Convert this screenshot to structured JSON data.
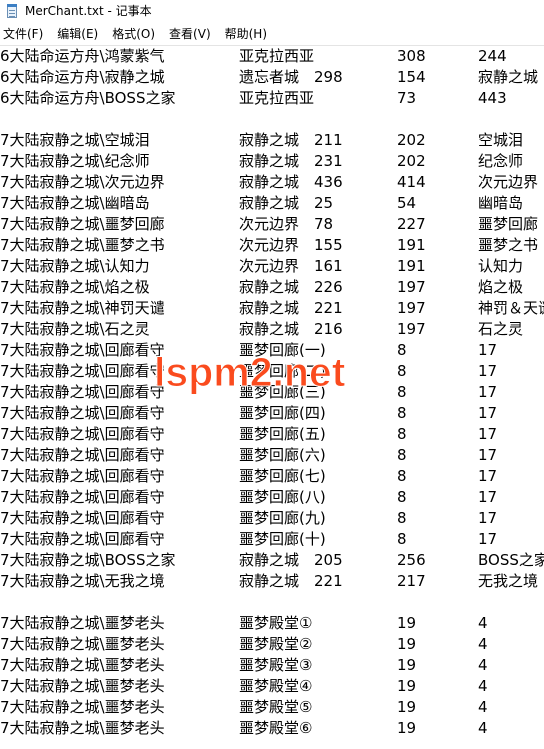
{
  "window": {
    "title": "MerChant.txt - 记事本",
    "app_icon": "notepad-icon"
  },
  "menu": [
    {
      "label": "文件(F)"
    },
    {
      "label": "编辑(E)"
    },
    {
      "label": "格式(O)"
    },
    {
      "label": "查看(V)"
    },
    {
      "label": "帮助(H)"
    }
  ],
  "watermark": "lspm2.net",
  "watermark_color": "#fa4b1e",
  "lines": [
    {
      "c1": "6大陆命运方舟\\鸿蒙紫气",
      "c2": "亚克拉西亚",
      "c3": "308",
      "c4": "244"
    },
    {
      "c1": "6大陆命运方舟\\寂静之城",
      "c2": "遗忘者城　298",
      "c3": "154",
      "c4": "寂静之城"
    },
    {
      "c1": "6大陆命运方舟\\BOSS之家",
      "c2": "亚克拉西亚",
      "c3": "73",
      "c4": "443"
    },
    {
      "c1": "",
      "c2": "",
      "c3": "",
      "c4": ""
    },
    {
      "c1": "7大陆寂静之城\\空城泪",
      "c2": "寂静之城　211",
      "c3": "202",
      "c4": "空城泪"
    },
    {
      "c1": "7大陆寂静之城\\纪念师",
      "c2": "寂静之城　231",
      "c3": "202",
      "c4": "纪念师"
    },
    {
      "c1": "7大陆寂静之城\\次元边界",
      "c2": "寂静之城　436",
      "c3": "414",
      "c4": "次元边界"
    },
    {
      "c1": "7大陆寂静之城\\幽暗岛",
      "c2": "寂静之城　25",
      "c3": "54",
      "c4": "幽暗岛"
    },
    {
      "c1": "7大陆寂静之城\\噩梦回廊",
      "c2": "次元边界　78",
      "c3": "227",
      "c4": "噩梦回廊"
    },
    {
      "c1": "7大陆寂静之城\\噩梦之书",
      "c2": "次元边界　155",
      "c3": "191",
      "c4": "噩梦之书"
    },
    {
      "c1": "7大陆寂静之城\\认知力",
      "c2": "次元边界　161",
      "c3": "191",
      "c4": "认知力"
    },
    {
      "c1": "7大陆寂静之城\\焰之极",
      "c2": "寂静之城　226",
      "c3": "197",
      "c4": "焰之极"
    },
    {
      "c1": "7大陆寂静之城\\神罚天谴",
      "c2": "寂静之城　221",
      "c3": "197",
      "c4": "神罚＆天谴"
    },
    {
      "c1": "7大陆寂静之城\\石之灵",
      "c2": "寂静之城　216",
      "c3": "197",
      "c4": "石之灵"
    },
    {
      "c1": "7大陆寂静之城\\回廊看守",
      "c2": "噩梦回廊(一)",
      "c3": "8",
      "c4": "17"
    },
    {
      "c1": "7大陆寂静之城\\回廊看守",
      "c2": "噩梦回廊(二)",
      "c3": "8",
      "c4": "17"
    },
    {
      "c1": "7大陆寂静之城\\回廊看守",
      "c2": "噩梦回廊(三)",
      "c3": "8",
      "c4": "17"
    },
    {
      "c1": "7大陆寂静之城\\回廊看守",
      "c2": "噩梦回廊(四)",
      "c3": "8",
      "c4": "17"
    },
    {
      "c1": "7大陆寂静之城\\回廊看守",
      "c2": "噩梦回廊(五)",
      "c3": "8",
      "c4": "17"
    },
    {
      "c1": "7大陆寂静之城\\回廊看守",
      "c2": "噩梦回廊(六)",
      "c3": "8",
      "c4": "17"
    },
    {
      "c1": "7大陆寂静之城\\回廊看守",
      "c2": "噩梦回廊(七)",
      "c3": "8",
      "c4": "17"
    },
    {
      "c1": "7大陆寂静之城\\回廊看守",
      "c2": "噩梦回廊(八)",
      "c3": "8",
      "c4": "17"
    },
    {
      "c1": "7大陆寂静之城\\回廊看守",
      "c2": "噩梦回廊(九)",
      "c3": "8",
      "c4": "17"
    },
    {
      "c1": "7大陆寂静之城\\回廊看守",
      "c2": "噩梦回廊(十)",
      "c3": "8",
      "c4": "17"
    },
    {
      "c1": "7大陆寂静之城\\BOSS之家",
      "c2": "寂静之城　205",
      "c3": "256",
      "c4": "BOSS之家"
    },
    {
      "c1": "7大陆寂静之城\\无我之境",
      "c2": "寂静之城　221",
      "c3": "217",
      "c4": "无我之境"
    },
    {
      "c1": "",
      "c2": "",
      "c3": "",
      "c4": ""
    },
    {
      "c1": "7大陆寂静之城\\噩梦老头",
      "c2": "噩梦殿堂①",
      "c3": "19",
      "c4": "4"
    },
    {
      "c1": "7大陆寂静之城\\噩梦老头",
      "c2": "噩梦殿堂②",
      "c3": "19",
      "c4": "4"
    },
    {
      "c1": "7大陆寂静之城\\噩梦老头",
      "c2": "噩梦殿堂③",
      "c3": "19",
      "c4": "4"
    },
    {
      "c1": "7大陆寂静之城\\噩梦老头",
      "c2": "噩梦殿堂④",
      "c3": "19",
      "c4": "4"
    },
    {
      "c1": "7大陆寂静之城\\噩梦老头",
      "c2": "噩梦殿堂⑤",
      "c3": "19",
      "c4": "4"
    },
    {
      "c1": "7大陆寂静之城\\噩梦老头",
      "c2": "噩梦殿堂⑥",
      "c3": "19",
      "c4": "4"
    }
  ]
}
